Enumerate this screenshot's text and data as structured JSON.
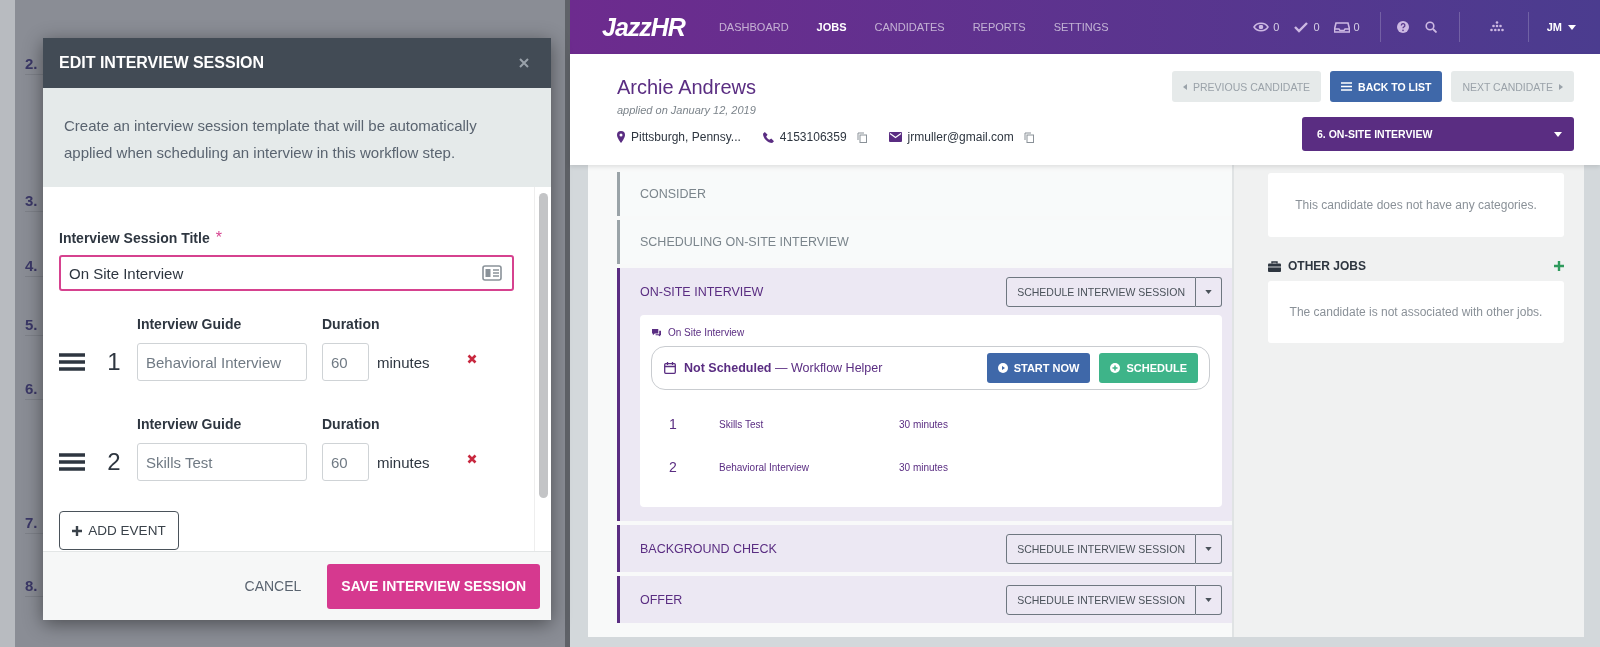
{
  "background_steps": [
    "2.",
    "3.",
    "4.",
    "5.",
    "6.",
    "7.",
    "8."
  ],
  "modal": {
    "title": "EDIT INTERVIEW SESSION",
    "description": "Create an interview session template that will be automatically applied when scheduling an interview in this workflow step.",
    "title_field": {
      "label": "Interview Session Title",
      "required_mark": "*",
      "value": "On Site Interview"
    },
    "events": [
      {
        "index": "1",
        "guide_label": "Interview Guide",
        "guide": "Behavioral Interview",
        "duration_label": "Duration",
        "duration": "60",
        "unit": "minutes"
      },
      {
        "index": "2",
        "guide_label": "Interview Guide",
        "guide": "Skills Test",
        "duration_label": "Duration",
        "duration": "60",
        "unit": "minutes"
      }
    ],
    "add_event": "ADD EVENT",
    "cancel": "CANCEL",
    "save": "SAVE INTERVIEW SESSION"
  },
  "nav": {
    "logo": "JazzHR",
    "items": [
      {
        "label": "DASHBOARD",
        "selected": false
      },
      {
        "label": "JOBS",
        "selected": true
      },
      {
        "label": "CANDIDATES",
        "selected": false
      },
      {
        "label": "REPORTS",
        "selected": false
      },
      {
        "label": "SETTINGS",
        "selected": false
      }
    ],
    "counters": [
      {
        "kind": "eye",
        "value": "0"
      },
      {
        "kind": "check",
        "value": "0"
      },
      {
        "kind": "inbox",
        "value": "0"
      }
    ],
    "user": "JM"
  },
  "candidate": {
    "name": "Archie Andrews",
    "applied": "applied on January 12, 2019",
    "location": "Pittsburgh, Pennsy...",
    "phone": "4153106359",
    "email": "jrmuller@gmail.com"
  },
  "pager": {
    "previous": "PREVIOUS CANDIDATE",
    "back": "BACK TO LIST",
    "next": "NEXT CANDIDATE"
  },
  "stage_dropdown": "6. ON-SITE INTERVIEW",
  "stages": [
    {
      "label": "CONSIDER",
      "kind": "past"
    },
    {
      "label": "SCHEDULING ON-SITE INTERVIEW",
      "kind": "past"
    },
    {
      "label": "ON-SITE INTERVIEW",
      "kind": "current",
      "action": "SCHEDULE INTERVIEW SESSION",
      "session": {
        "title": "On Site Interview",
        "status": "**Not Scheduled** — Workflow Helper",
        "start": "START NOW",
        "schedule": "SCHEDULE",
        "events": [
          {
            "index": "1",
            "name": "Skills Test",
            "duration": "30 minutes"
          },
          {
            "index": "2",
            "name": "Behavioral Interview",
            "duration": "30 minutes"
          }
        ]
      }
    },
    {
      "label": "BACKGROUND CHECK",
      "kind": "upcoming",
      "action": "SCHEDULE INTERVIEW SESSION"
    },
    {
      "label": "OFFER",
      "kind": "upcoming",
      "action": "SCHEDULE INTERVIEW SESSION"
    }
  ],
  "sidebar": {
    "categories_note": "This candidate does not have any categories.",
    "other_jobs": {
      "title": "OTHER JOBS",
      "note": "The candidate is not associated with other jobs."
    }
  }
}
